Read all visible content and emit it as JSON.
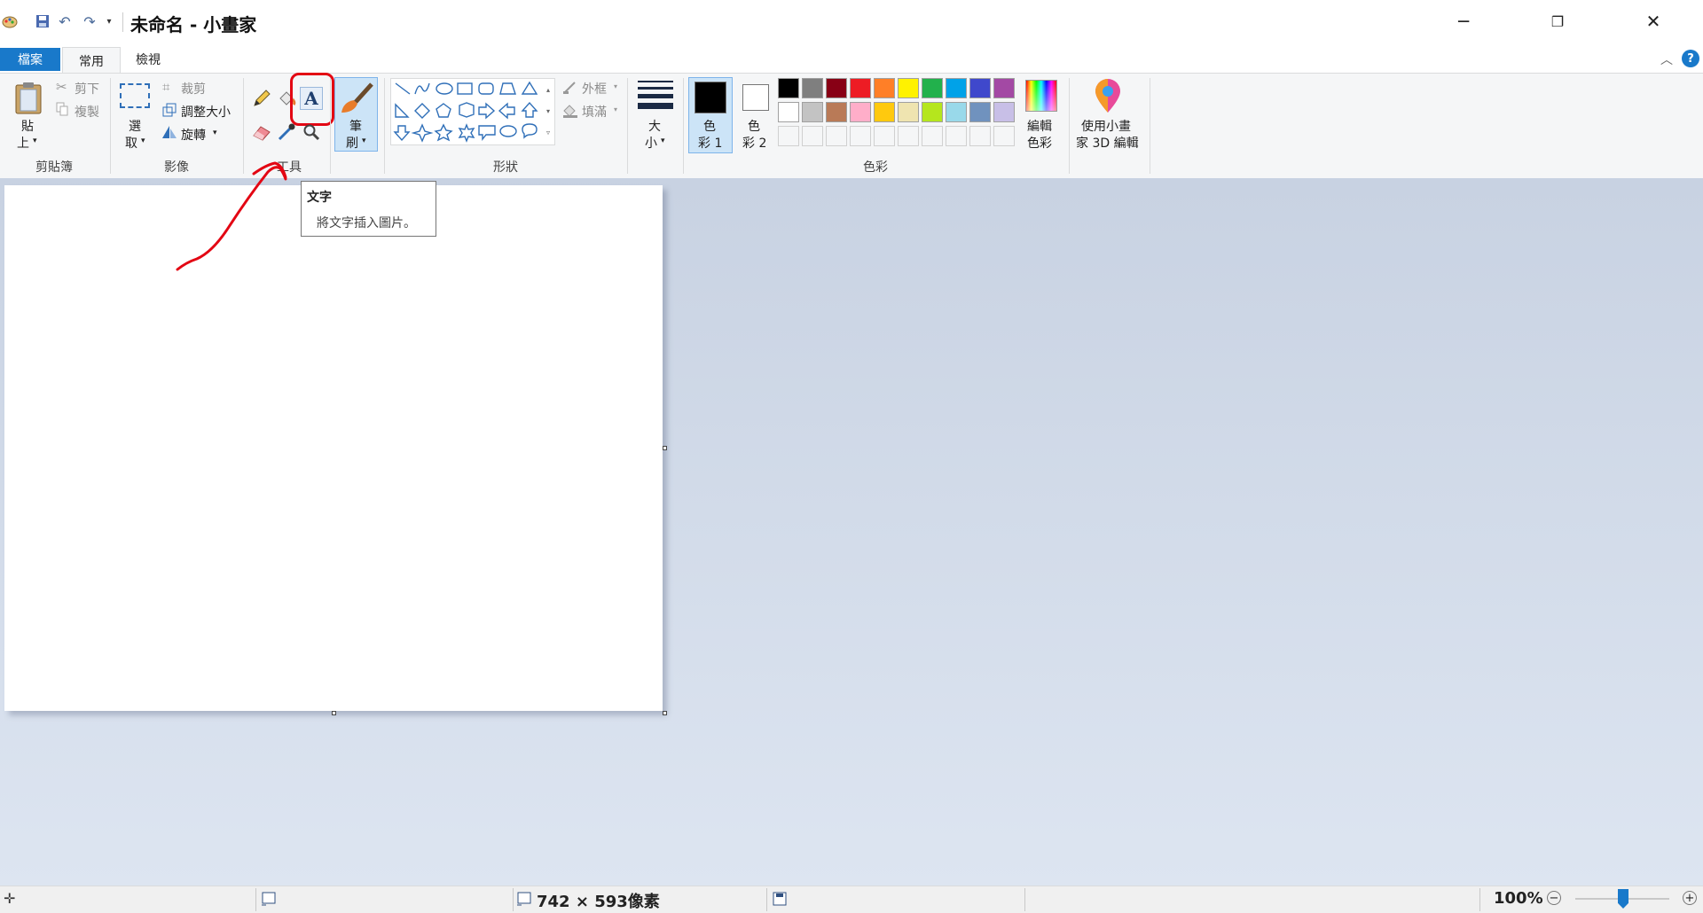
{
  "window": {
    "title": "未命名 - 小畫家"
  },
  "tabs": [
    {
      "label": "檔案"
    },
    {
      "label": "常用"
    },
    {
      "label": "檢視"
    }
  ],
  "ribbon": {
    "clipboard": {
      "paste": "貼",
      "paste2": "上",
      "cut": "剪下",
      "copy": "複製",
      "group": "剪貼簿"
    },
    "image": {
      "select": "選",
      "select2": "取",
      "crop": "裁剪",
      "resize": "調整大小",
      "rotate": "旋轉",
      "group": "影像"
    },
    "tools": {
      "group": "工具"
    },
    "brushes": {
      "label": "筆",
      "label2": "刷"
    },
    "shapes": {
      "outline": "外框",
      "fill": "填滿",
      "group": "形狀"
    },
    "size": {
      "label": "大",
      "label2": "小"
    },
    "colors": {
      "color1": "色",
      "color1b": "彩 1",
      "color2": "色",
      "color2b": "彩 2",
      "edit": "編輯",
      "edit2": "色彩",
      "group": "色彩",
      "row1": [
        "#000000",
        "#7f7f7f",
        "#880015",
        "#ed1c24",
        "#ff7f27",
        "#fff200",
        "#22b14c",
        "#00a2e8",
        "#3f48cc",
        "#a349a4"
      ],
      "row2": [
        "#ffffff",
        "#c3c3c3",
        "#b97a57",
        "#ffaec9",
        "#ffc90e",
        "#efe4b0",
        "#b5e61d",
        "#99d9ea",
        "#7092be",
        "#c8bfe7"
      ],
      "primary": "#000000",
      "secondary": "#ffffff"
    },
    "paint3d": {
      "label": "使用小畫",
      "label2": "家 3D 編輯"
    }
  },
  "tooltip": {
    "title": "文字",
    "desc": "將文字插入圖片。"
  },
  "status": {
    "size": "742 × 593像素",
    "zoom": "100%"
  },
  "accent": "#1979ca",
  "annotation_color": "#e30613"
}
